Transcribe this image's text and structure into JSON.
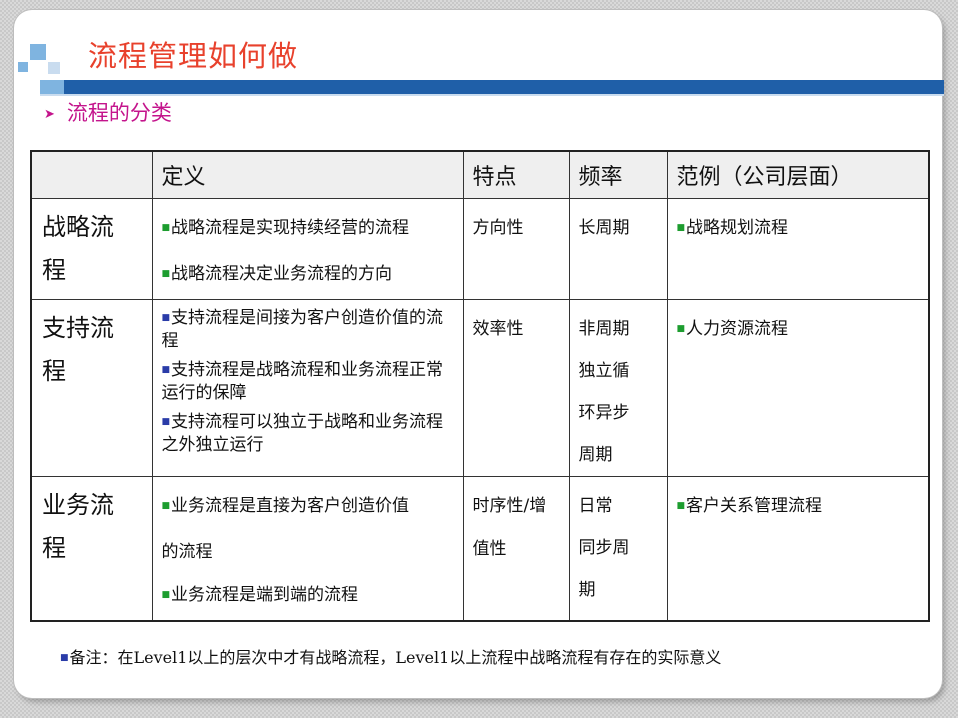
{
  "header": {
    "title": "流程管理如何做",
    "subtitle": "流程的分类"
  },
  "colors": {
    "title": "#e8412c",
    "subtitle": "#c4148c",
    "bar_dark": "#1f5fa8",
    "bar_light": "#7fb4e0"
  },
  "table": {
    "headers": [
      "",
      "定义",
      "特点",
      "频率",
      "范例（公司层面）"
    ],
    "rows": [
      {
        "name_line1": "战略流",
        "name_line2": "程",
        "definitions": [
          "战略流程是实现持续经营的流程",
          "战略流程决定业务流程的方向"
        ],
        "feature": "方向性",
        "frequency": [
          "长周期"
        ],
        "example": "战略规划流程"
      },
      {
        "name_line1": "支持流",
        "name_line2": "程",
        "definitions": [
          "支持流程是间接为客户创造价值的流程",
          "支持流程是战略流程和业务流程正常运行的保障",
          "支持流程可以独立于战略和业务流程之外独立运行"
        ],
        "feature": "效率性",
        "frequency": [
          "非周期",
          "独立循",
          "环异步",
          "周期"
        ],
        "example": "人力资源流程"
      },
      {
        "name_line1": "业务流",
        "name_line2": "程",
        "definitions": [
          "业务流程是直接为客户创造价值",
          "的流程",
          "业务流程是端到端的流程"
        ],
        "feature_line1": "时序性/增",
        "feature_line2": "值性",
        "frequency": [
          "日常",
          "同步周",
          "期"
        ],
        "example": "客户关系管理流程"
      }
    ]
  },
  "note": "备注：在Level1以上的层次中才有战略流程，Level1以上流程中战略流程有存在的实际意义"
}
